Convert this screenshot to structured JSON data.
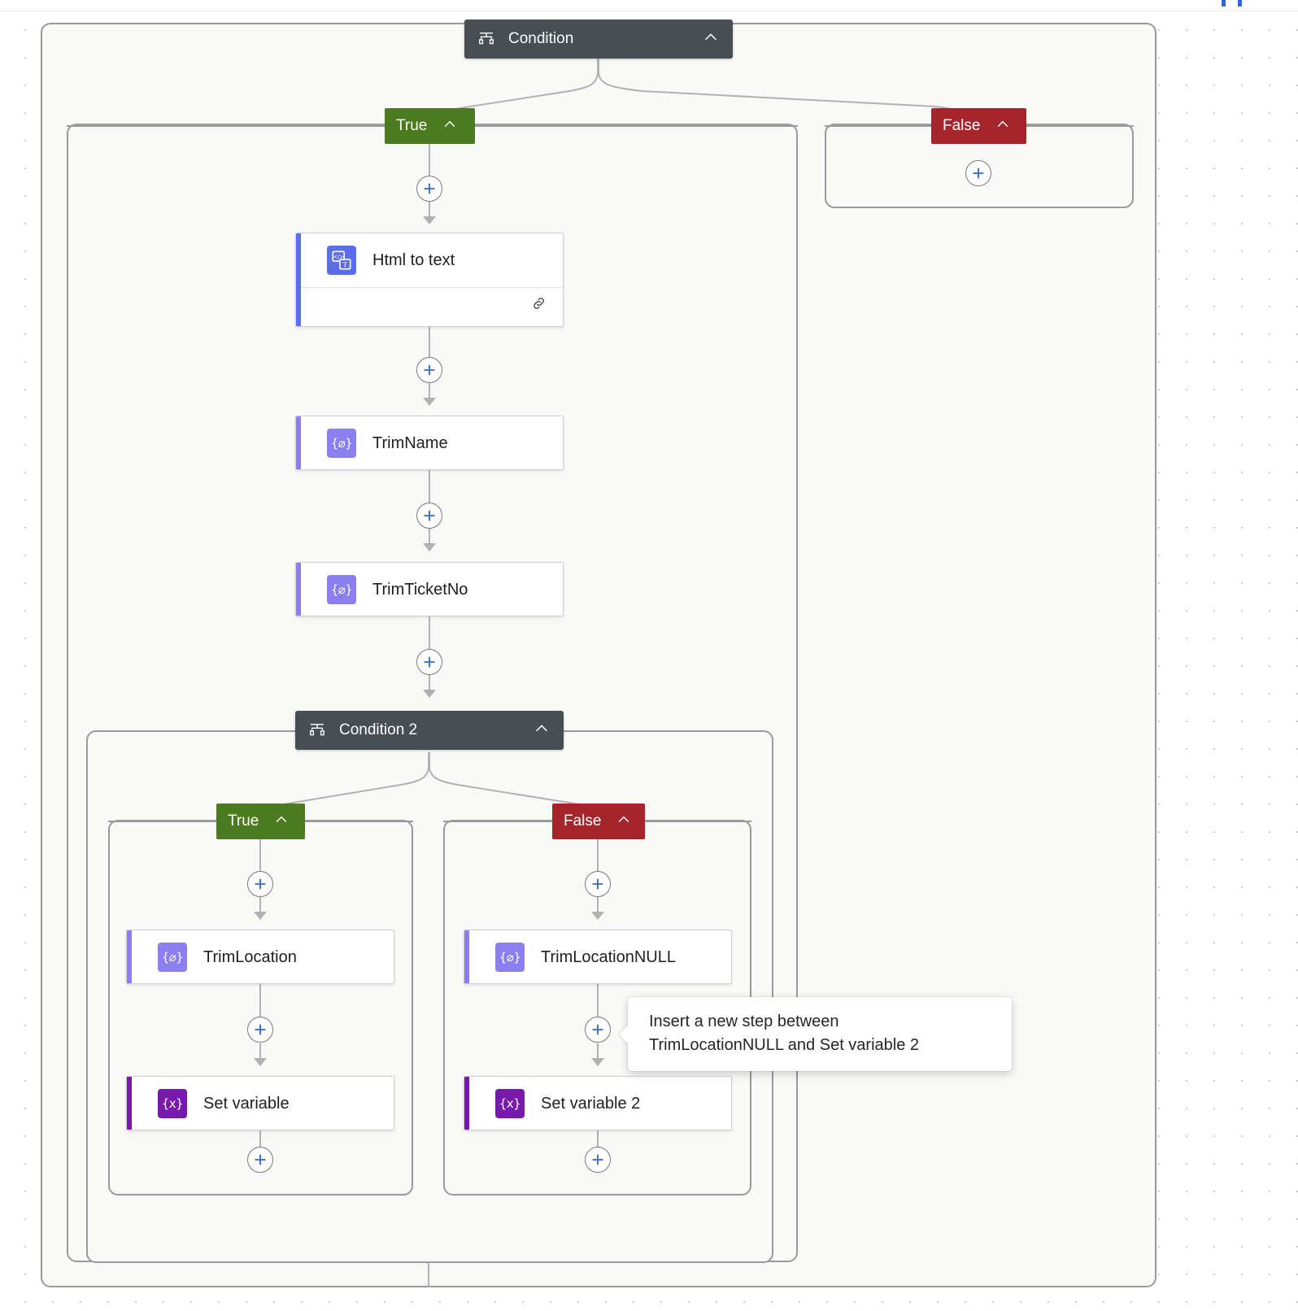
{
  "app": {
    "title": "Power Automate flow designer canvas"
  },
  "toolbar": {
    "marks": [
      "",
      ""
    ]
  },
  "root_condition": {
    "title": "Condition",
    "icon": "condition-icon",
    "collapse_icon": "chevron-up-icon",
    "branches": {
      "true_label": "True",
      "false_label": "False"
    }
  },
  "nested_condition": {
    "title": "Condition 2",
    "icon": "condition-icon",
    "collapse_icon": "chevron-up-icon",
    "branches": {
      "true_label": "True",
      "false_label": "False"
    }
  },
  "actions": {
    "html_to_text": {
      "title": "Html to text",
      "icon": "html-to-text-icon",
      "icon_glyph": "</>",
      "icon_glyph2": "T",
      "accent_color": "#5b6ee8",
      "icon_color": "#5b6ee8",
      "footer_icon": "link-icon"
    },
    "trim_name": {
      "title": "TrimName",
      "icon": "compose-icon",
      "icon_glyph": "{⌀}",
      "accent_color": "#8b7ef0",
      "icon_color": "#8b7ef0"
    },
    "trim_ticket_no": {
      "title": "TrimTicketNo",
      "icon": "compose-icon",
      "icon_glyph": "{⌀}",
      "accent_color": "#8b7ef0",
      "icon_color": "#8b7ef0"
    },
    "trim_location": {
      "title": "TrimLocation",
      "icon": "compose-icon",
      "icon_glyph": "{⌀}",
      "accent_color": "#8b7ef0",
      "icon_color": "#8b7ef0"
    },
    "trim_location_null": {
      "title": "TrimLocationNULL",
      "icon": "compose-icon",
      "icon_glyph": "{⌀}",
      "accent_color": "#8b7ef0",
      "icon_color": "#8b7ef0"
    },
    "set_variable": {
      "title": "Set variable",
      "icon": "set-variable-icon",
      "icon_glyph": "{x}",
      "accent_color": "#7719aa",
      "icon_color": "#7719aa"
    },
    "set_variable_2": {
      "title": "Set variable 2",
      "icon": "set-variable-icon",
      "icon_glyph": "{x}",
      "accent_color": "#7719aa",
      "icon_color": "#7719aa"
    }
  },
  "insert_buttons": {
    "label": "+",
    "icon": "plus-icon"
  },
  "tooltip": {
    "line1": "Insert a new step between",
    "line2": "TrimLocationNULL and Set variable 2"
  },
  "colors": {
    "branch_true": "#4c7a1e",
    "branch_false": "#a4262c",
    "condition_header": "#474f55",
    "plus_blue": "#3267d6",
    "connector_gray": "#b1b1b1",
    "scope_bg": "#f9f9f7",
    "scope_border": "#9a9a9a",
    "canvas_bg": "#ffffff"
  }
}
